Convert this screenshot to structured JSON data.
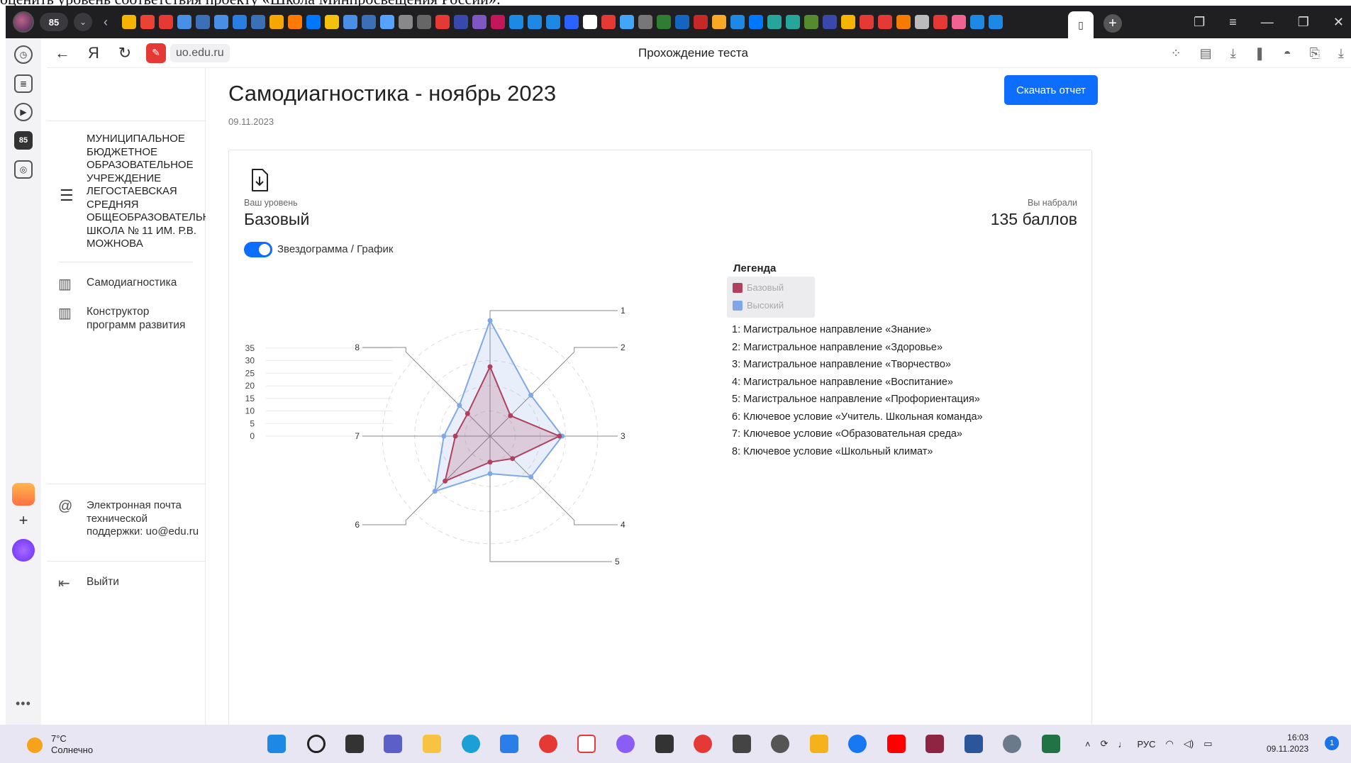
{
  "doc_fragment": "оценить уровень соответствия проекту «Школа Минпросвещения России»:",
  "browser": {
    "tab_count": "85",
    "url": "uo.edu.ru",
    "page_title": "Прохождение теста"
  },
  "sidebar": {
    "school": "МУНИЦИПАЛЬНОЕ\nБЮДЖЕТНОЕ\nОБРАЗОВАТЕЛЬНОЕ\nУЧРЕЖДЕНИЕ\nЛЕГОСТАЕВСКАЯ\nСРЕДНЯЯ\nОБЩЕОБРАЗОВАТЕЛЬН\nШКОЛА № 11 ИМ. Р.В.\nМОЖНОВА",
    "items": [
      {
        "label": "Самодиагностика"
      },
      {
        "label": "Конструктор программ развития"
      }
    ],
    "support": "Электронная почта технической поддержки: uo@edu.ru",
    "logout": "Выйти"
  },
  "main": {
    "title": "Самодиагностика - ноябрь 2023",
    "date": "09.11.2023",
    "download_button": "Скачать отчет",
    "level_label": "Ваш уровень",
    "level_value": "Базовый",
    "score_label": "Вы набрали",
    "score_value": "135 баллов",
    "toggle_label": "Звездограмма / График"
  },
  "legend": {
    "title": "Легенда",
    "items": [
      {
        "label": "Базовый",
        "color": "#b0415e"
      },
      {
        "label": "Высокий",
        "color": "#7fa8e8"
      }
    ],
    "directions": [
      "1: Магистральное направление «Знание»",
      "2: Магистральное направление «Здоровье»",
      "3: Магистральное направление «Творчество»",
      "4: Магистральное направление «Воспитание»",
      "5: Магистральное направление «Профориентация»",
      "6: Ключевое условие «Учитель. Школьная команда»",
      "7: Ключевое условие «Образовательная среда»",
      "8: Ключевое условие «Школьный климат»"
    ]
  },
  "chart_data": {
    "type": "radar",
    "axes": [
      "1",
      "2",
      "3",
      "4",
      "5",
      "6",
      "7",
      "8"
    ],
    "scale_ticks": [
      0,
      5,
      10,
      15,
      20,
      25,
      30,
      35
    ],
    "rmax": 40,
    "series": [
      {
        "name": "Базовый",
        "color": "#b0415e",
        "values": [
          24,
          10,
          24,
          11,
          9,
          22,
          12,
          11
        ]
      },
      {
        "name": "Высокий",
        "color": "#7fa8e8",
        "values": [
          40,
          20,
          25,
          20,
          13,
          27,
          16,
          15
        ]
      }
    ]
  },
  "taskbar": {
    "temperature": "7°C",
    "weather": "Солнечно",
    "lang": "РУС",
    "time": "16:03",
    "date": "09.11.2023",
    "notifications": "1"
  }
}
